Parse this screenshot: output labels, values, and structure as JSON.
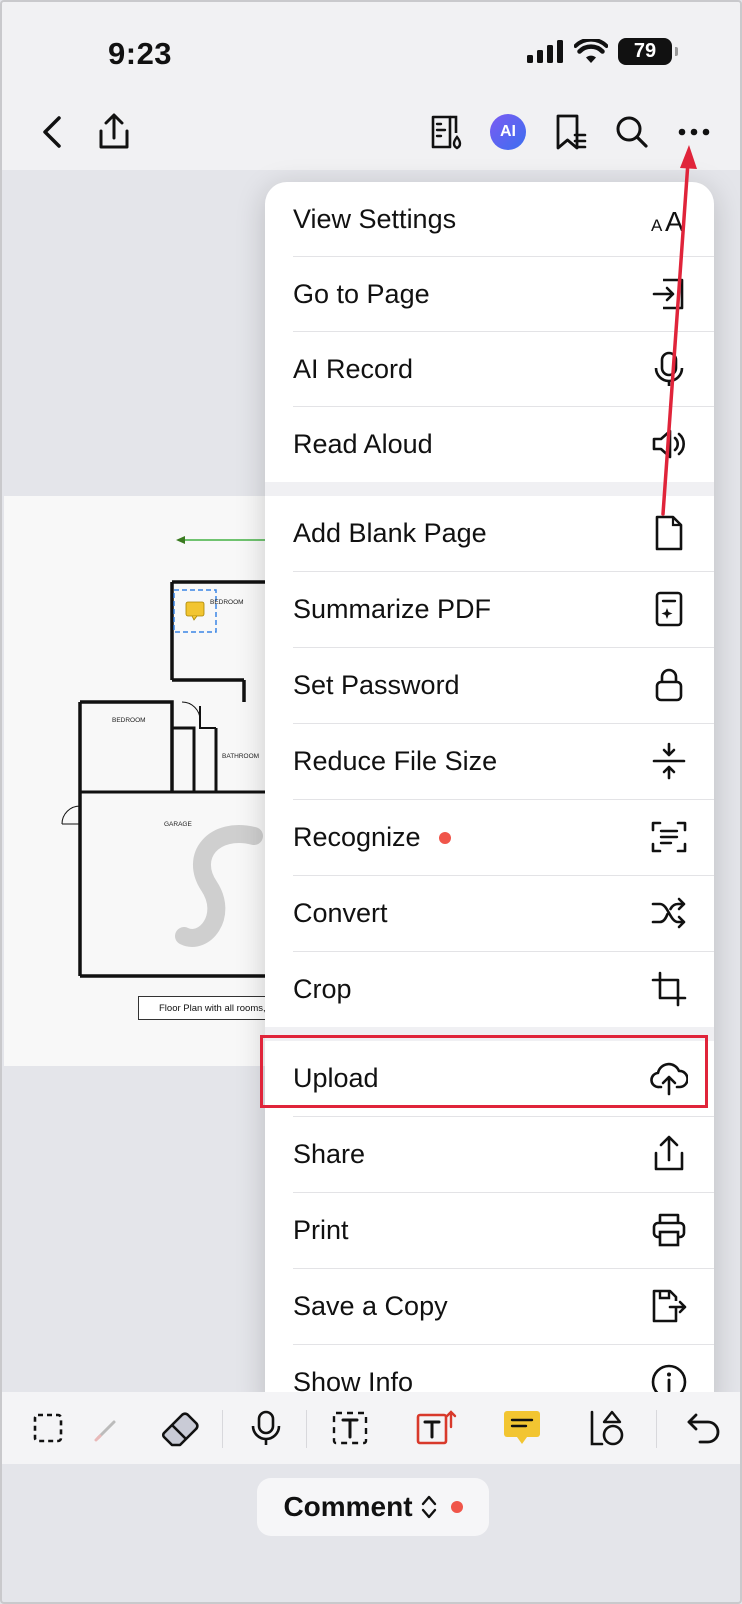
{
  "status": {
    "time": "9:23",
    "battery": "79"
  },
  "menu": {
    "items": [
      {
        "label": "View Settings",
        "icon": "text-size-icon"
      },
      {
        "label": "Go to Page",
        "icon": "go-to-page-icon"
      },
      {
        "label": "AI Record",
        "icon": "ai-record-mic-icon"
      },
      {
        "label": "Read Aloud",
        "icon": "read-aloud-speaker-icon"
      },
      {
        "label": "Add Blank Page",
        "icon": "blank-page-icon"
      },
      {
        "label": "Summarize PDF",
        "icon": "summarize-document-icon"
      },
      {
        "label": "Set Password",
        "icon": "lock-icon"
      },
      {
        "label": "Reduce File Size",
        "icon": "compress-icon"
      },
      {
        "label": "Recognize",
        "icon": "scan-text-icon",
        "badge": true
      },
      {
        "label": "Convert",
        "icon": "shuffle-convert-icon"
      },
      {
        "label": "Crop",
        "icon": "crop-icon"
      },
      {
        "label": "Upload",
        "icon": "cloud-upload-icon",
        "highlighted": true
      },
      {
        "label": "Share",
        "icon": "share-icon"
      },
      {
        "label": "Print",
        "icon": "printer-icon"
      },
      {
        "label": "Save a Copy",
        "icon": "save-copy-icon"
      },
      {
        "label": "Show Info",
        "icon": "info-icon"
      }
    ]
  },
  "document": {
    "caption": "Floor Plan with all rooms,",
    "rooms": {
      "bedroom_top": "BEDROOM",
      "bedroom_left": "BEDROOM",
      "bathroom": "BATHROOM",
      "garage": "GARAGE"
    }
  },
  "bottom": {
    "mode_label": "Comment"
  },
  "colors": {
    "accent_red": "#e0243a",
    "badge_dot": "#f0554a",
    "ai_gradient_start": "#7b5bf2",
    "ai_gradient_end": "#3b6ff0"
  }
}
